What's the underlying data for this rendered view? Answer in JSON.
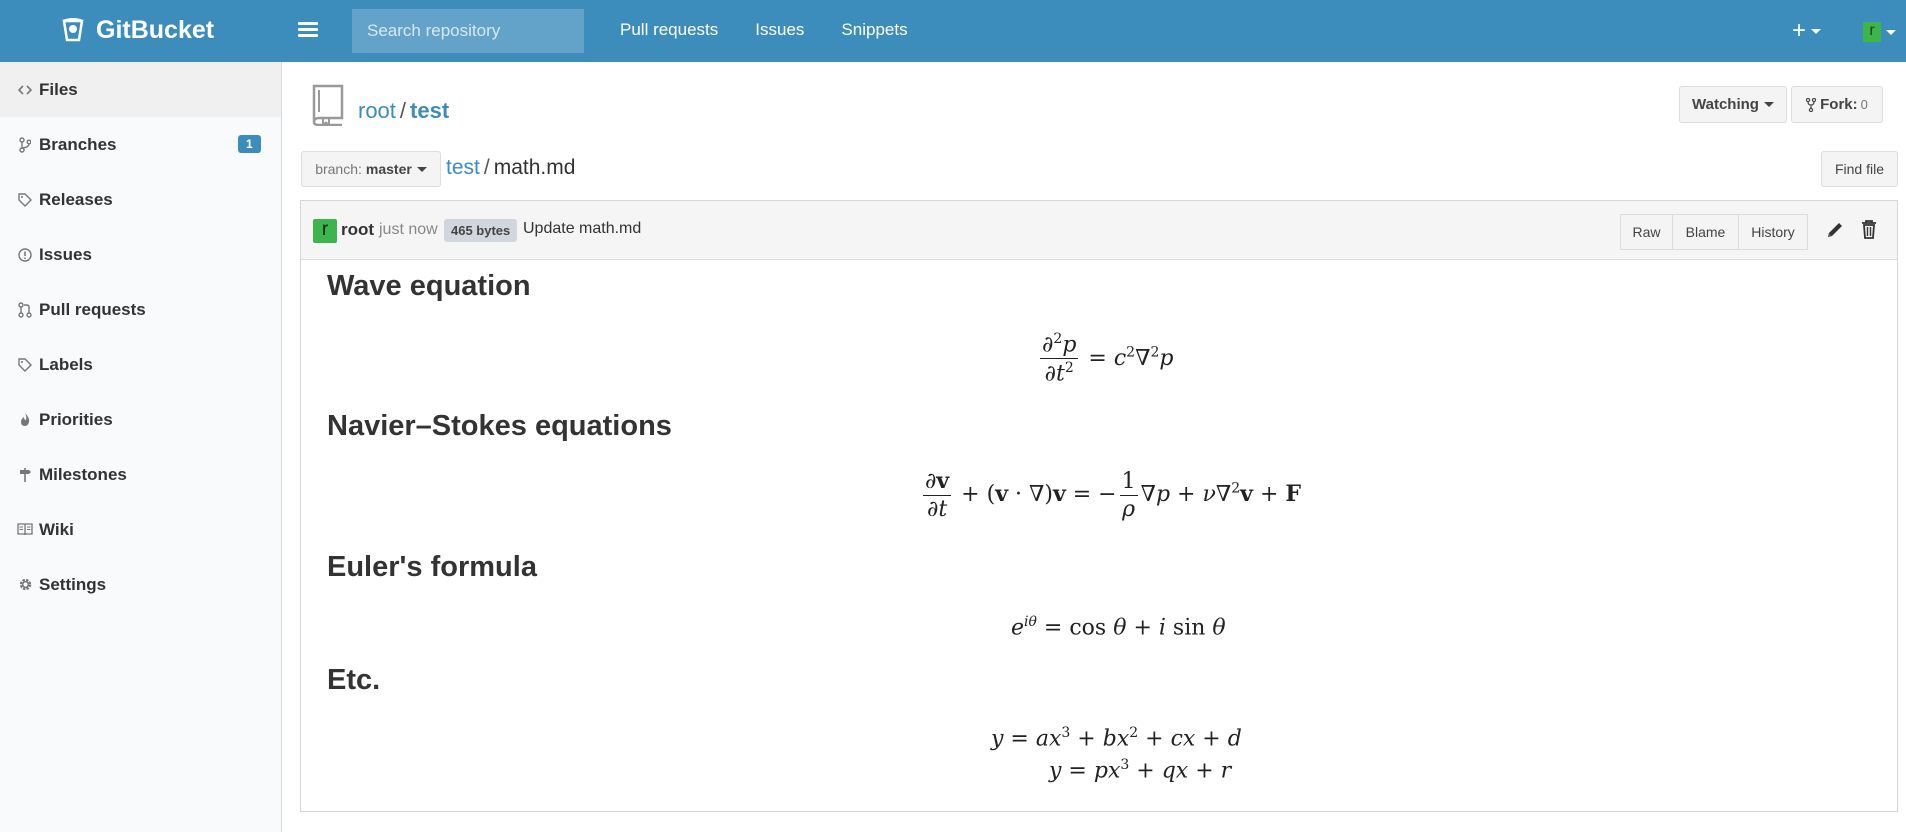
{
  "navbar": {
    "brand": "GitBucket",
    "search_placeholder": "Search repository",
    "links": [
      "Pull requests",
      "Issues",
      "Snippets"
    ],
    "plus_label": "+",
    "user_initial": "r",
    "bg_color": "#3c8dbc"
  },
  "sidebar": {
    "items": [
      {
        "label": "Files",
        "icon": "code-icon",
        "active": true
      },
      {
        "label": "Branches",
        "icon": "branch-icon",
        "badge": "1"
      },
      {
        "label": "Releases",
        "icon": "tag-icon"
      },
      {
        "label": "Issues",
        "icon": "issue-icon"
      },
      {
        "label": "Pull requests",
        "icon": "pull-request-icon"
      },
      {
        "label": "Labels",
        "icon": "tag-icon"
      },
      {
        "label": "Priorities",
        "icon": "flame-icon"
      },
      {
        "label": "Milestones",
        "icon": "milestone-icon"
      },
      {
        "label": "Wiki",
        "icon": "book-icon"
      },
      {
        "label": "Settings",
        "icon": "gear-icon"
      }
    ]
  },
  "repo": {
    "owner": "root",
    "name": "test",
    "watch_label": "Watching",
    "fork_label": "Fork:",
    "fork_count": "0"
  },
  "file": {
    "branch_prefix": "branch:",
    "branch": "master",
    "breadcrumb_repo": "test",
    "breadcrumb_file": "math.md",
    "find_file_label": "Find file"
  },
  "commit": {
    "avatar": "r",
    "user": "root",
    "time": "just now",
    "size": "465 bytes",
    "message": "Update math.md",
    "actions": [
      "Raw",
      "Blame",
      "History"
    ]
  },
  "content": {
    "headings": [
      "Wave equation",
      "Navier–Stokes equations",
      "Euler's formula",
      "Etc."
    ]
  }
}
